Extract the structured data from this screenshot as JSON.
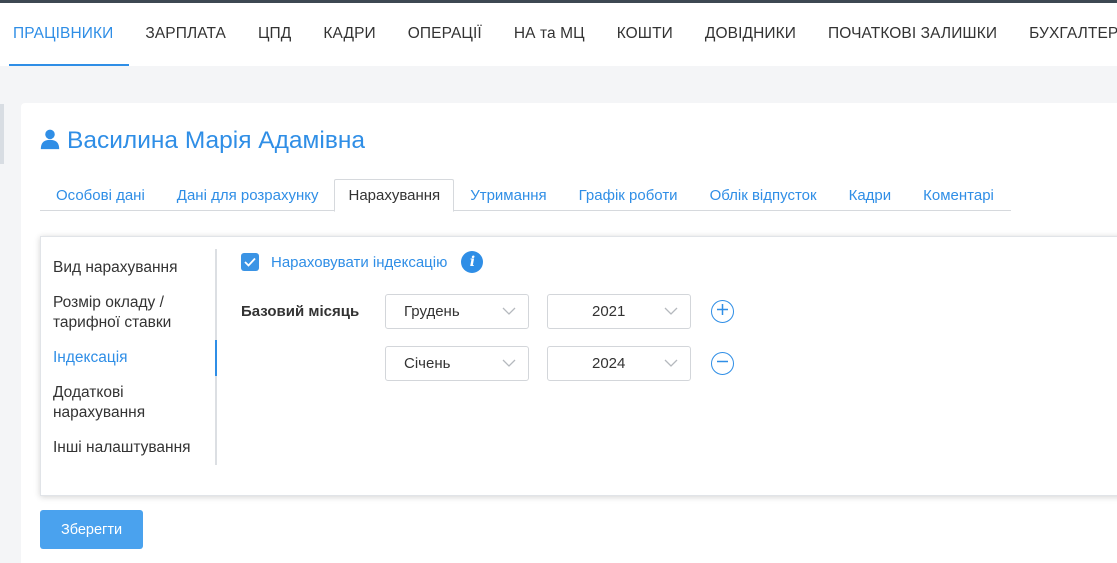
{
  "nav": {
    "items": [
      {
        "label": "ПРАЦІВНИКИ"
      },
      {
        "label": "ЗАРПЛАТА"
      },
      {
        "label": "ЦПД"
      },
      {
        "label": "КАДРИ"
      },
      {
        "label": "ОПЕРАЦІЇ"
      },
      {
        "label": "НА та МЦ"
      },
      {
        "label": "КОШТИ"
      },
      {
        "label": "ДОВІДНИКИ"
      },
      {
        "label": "ПОЧАТКОВІ ЗАЛИШКИ"
      },
      {
        "label": "БУХГАЛТЕРІЯ"
      }
    ],
    "active_index": 0
  },
  "employee": {
    "name": "Василина Марія Адамівна",
    "icon": "user-icon"
  },
  "tabs": [
    {
      "label": "Особові дані"
    },
    {
      "label": "Дані для розрахунку"
    },
    {
      "label": "Нарахування"
    },
    {
      "label": "Утримання"
    },
    {
      "label": "Графік роботи"
    },
    {
      "label": "Облік відпусток"
    },
    {
      "label": "Кадри"
    },
    {
      "label": "Коментарі"
    }
  ],
  "active_tab_index": 2,
  "side_menu": [
    {
      "label": "Вид нарахування"
    },
    {
      "label": "Розмір окладу / тарифної ставки"
    },
    {
      "label": "Індексація"
    },
    {
      "label": "Додаткові нарахування"
    },
    {
      "label": "Інші налаштування"
    }
  ],
  "active_side_index": 2,
  "indexation": {
    "checkbox_label": "Нараховувати індексацію",
    "checked": true,
    "base_month_label": "Базовий місяць",
    "rows": [
      {
        "month": "Грудень",
        "year": "2021",
        "action": "add"
      },
      {
        "month": "Січень",
        "year": "2024",
        "action": "remove"
      }
    ]
  },
  "save_label": "Зберегти",
  "colors": {
    "accent": "#2f8ee6",
    "button": "#4aa2ee",
    "topbar_border": "#3d4852"
  }
}
